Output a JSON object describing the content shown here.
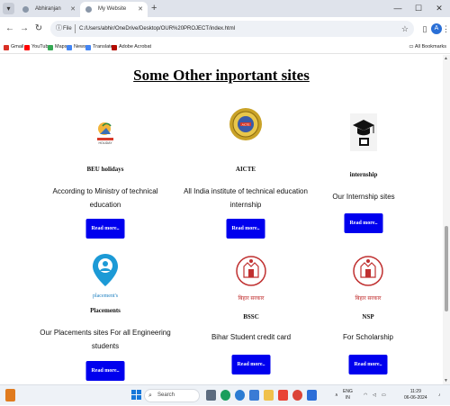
{
  "browser": {
    "tabs": [
      {
        "label": "Abhiranjan",
        "active": false
      },
      {
        "label": "My Website",
        "active": true
      }
    ],
    "window_controls": [
      "minimize",
      "maximize",
      "close"
    ],
    "omnibox": {
      "scheme_label": "File",
      "url": "C:/Users/abhir/OneDrive/Desktop/OUR%20PROJECT/index.html"
    },
    "bookmarks": [
      {
        "label": "Gmail",
        "color": "#d93025"
      },
      {
        "label": "YouTube",
        "color": "#ff0000"
      },
      {
        "label": "Maps",
        "color": "#34a853"
      },
      {
        "label": "News",
        "color": "#4285f4"
      },
      {
        "label": "Translate",
        "color": "#4285f4"
      },
      {
        "label": "Adobe Acrobat",
        "color": "#b30b00"
      }
    ],
    "all_bookmarks_label": "All Bookmarks",
    "profile_initial": "A"
  },
  "page": {
    "title": "Some Other inportant sites",
    "button_color": "#0000ee",
    "cards": [
      {
        "name": "BEU holidays",
        "description": "According to Ministry of technical education",
        "button": "Read more..",
        "icon": "beu-holiday-logo"
      },
      {
        "name": "AICTE",
        "description": "All India institute of technical education internship",
        "button": "Read more..",
        "icon": "aicte-logo"
      },
      {
        "name": "internship",
        "description": "Our Internship sites",
        "button": "Read more..",
        "icon": "graduation-cap-logo"
      },
      {
        "name": "Placements",
        "description": "Our Placements sites For all Engineering students",
        "button": "Read more..",
        "icon": "placements-logo",
        "logo_text": "placement's"
      },
      {
        "name": "BSSC",
        "description": "Bihar Student credit card",
        "button": "Read more..",
        "icon": "bihar-emblem-logo",
        "logo_text": "बिहार सरकार"
      },
      {
        "name": "NSP",
        "description": "For Scholarship",
        "button": "Read more..",
        "icon": "bihar-emblem-logo",
        "logo_text": "बिहार सरकार"
      }
    ]
  },
  "taskbar": {
    "search_placeholder": "Search",
    "language": "ENG",
    "language_sub": "IN",
    "time": "11:29",
    "date": "06-06-2024"
  }
}
